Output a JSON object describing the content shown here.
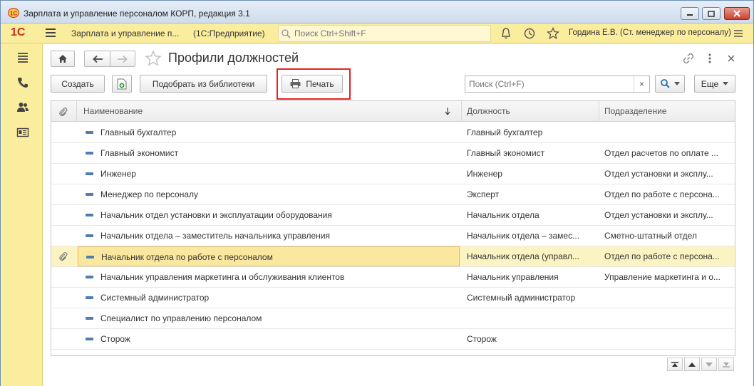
{
  "window": {
    "title": "Зарплата и управление персоналом КОРП, редакция 3.1"
  },
  "topbar": {
    "logo": "1С",
    "app_name": "Зарплата и управление п...",
    "platform": "(1С:Предприятие)",
    "search_placeholder": "Поиск Ctrl+Shift+F",
    "user": "Гордина Е.В. (Ст. менеджер по персоналу)"
  },
  "page": {
    "title": "Профили должностей"
  },
  "toolbar": {
    "create": "Создать",
    "pick_from_library": "Подобрать из библиотеки",
    "print": "Печать",
    "search_placeholder": "Поиск (Ctrl+F)",
    "clear": "×",
    "more": "Еще"
  },
  "table": {
    "columns": [
      "Наименование",
      "Должность",
      "Подразделение"
    ],
    "rows": [
      {
        "name": "Главный бухгалтер",
        "position": "Главный бухгалтер",
        "department": "",
        "attached": false,
        "selected": false
      },
      {
        "name": "Главный экономист",
        "position": "Главный экономист",
        "department": "Отдел расчетов по оплате ...",
        "attached": false,
        "selected": false
      },
      {
        "name": "Инженер",
        "position": "Инженер",
        "department": "Отдел установки и эксплу...",
        "attached": false,
        "selected": false
      },
      {
        "name": "Менеджер по персоналу",
        "position": "Эксперт",
        "department": "Отдел по работе с персона...",
        "attached": false,
        "selected": false
      },
      {
        "name": "Начальник отдел установки и эксплуатации оборудования",
        "position": "Начальник отдела",
        "department": "Отдел установки и эксплу...",
        "attached": false,
        "selected": false
      },
      {
        "name": "Начальник отдела – заместитель начальника управления",
        "position": "Начальник отдела – замес...",
        "department": "Сметно-штатный отдел",
        "attached": false,
        "selected": false
      },
      {
        "name": "Начальник отдела по работе с персоналом",
        "position": "Начальник отдела (управл...",
        "department": "Отдел по работе с персона...",
        "attached": true,
        "selected": true
      },
      {
        "name": "Начальник управления маркетинга и обслуживания клиентов",
        "position": "Начальник управления",
        "department": "Управление маркетинга и о...",
        "attached": false,
        "selected": false
      },
      {
        "name": "Системный администратор",
        "position": "Системный администратор",
        "department": "",
        "attached": false,
        "selected": false
      },
      {
        "name": "Специалист по управлению персоналом",
        "position": "",
        "department": "",
        "attached": false,
        "selected": false
      },
      {
        "name": "Сторож",
        "position": "Сторож",
        "department": "",
        "attached": false,
        "selected": false
      }
    ]
  },
  "colors": {
    "accent_yellow": "#fbed9e",
    "highlight_red": "#e52222",
    "selected_row": "#fcf3c2"
  }
}
